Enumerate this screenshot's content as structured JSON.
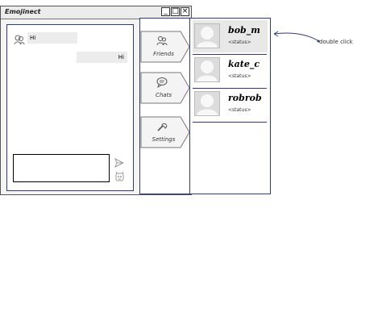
{
  "window": {
    "title": "Emojinect",
    "minimize_glyph": "_",
    "maximize_glyph": "□",
    "close_glyph": "×"
  },
  "chat": {
    "messages": [
      {
        "direction": "incoming",
        "text": "Hi"
      },
      {
        "direction": "outgoing",
        "text": "Hi"
      }
    ],
    "input_value": "",
    "icons": {
      "send": "send-icon",
      "emoji": "emoji-icon",
      "sender": "user-icon"
    }
  },
  "tabs": [
    {
      "label": "Friends",
      "icon": "users-icon"
    },
    {
      "label": "Chats",
      "icon": "chat-bubble-icon"
    },
    {
      "label": "Settings",
      "icon": "wrench-icon"
    }
  ],
  "friends": [
    {
      "name": "bob_m",
      "status": "<status>",
      "selected": true
    },
    {
      "name": "kate_c",
      "status": "<status>",
      "selected": false
    },
    {
      "name": "robrob",
      "status": "<status>",
      "selected": false
    }
  ],
  "annotation": {
    "text": "double click"
  },
  "colors": {
    "panel_border": "#2b3d7a",
    "bubble": "#ececec",
    "selected_row": "#e8e8e8"
  }
}
